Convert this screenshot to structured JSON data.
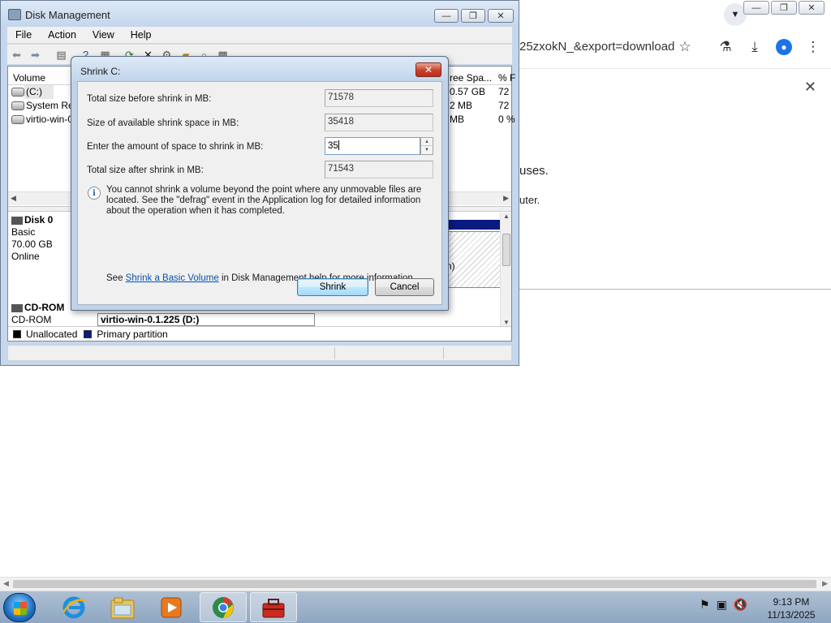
{
  "browser": {
    "url_fragment": "25zxokN_&export=download",
    "content_text_1": "uses.",
    "content_text_2": "uter.",
    "win_ctrls": [
      "—",
      "❐",
      "✕"
    ],
    "tab_dropdown_icon": "chevron-down-icon"
  },
  "disk_mgmt": {
    "title": "Disk Management",
    "menu": [
      "File",
      "Action",
      "View",
      "Help"
    ],
    "columns": [
      "Volume",
      "ree Spa...",
      "% F"
    ],
    "volumes": [
      {
        "name": "(C:)",
        "free": "0.57 GB",
        "pct": "72"
      },
      {
        "name": "System Res",
        "free": "2 MB",
        "pct": "72"
      },
      {
        "name": "virtio-win-0",
        "free": "MB",
        "pct": "0 %"
      }
    ],
    "disk0": {
      "name": "Disk 0",
      "type": "Basic",
      "size": "70.00 GB",
      "status": "Online"
    },
    "partition_text": "n)",
    "cdrom": {
      "name": "CD-ROM",
      "type": "CD-ROM",
      "volume": "virtio-win-0.1.225 (D:)"
    },
    "legend": [
      {
        "label": "Unallocated",
        "color": "#000000"
      },
      {
        "label": "Primary partition",
        "color": "#0a1a80"
      }
    ]
  },
  "dialog": {
    "title": "Shrink C:",
    "fields": {
      "total_before": {
        "label": "Total size before shrink in MB:",
        "value": "71578"
      },
      "available": {
        "label": "Size of available shrink space in MB:",
        "value": "35418"
      },
      "amount": {
        "label": "Enter the amount of space to shrink in MB:",
        "value": "35"
      },
      "total_after": {
        "label": "Total size after shrink in MB:",
        "value": "71543"
      }
    },
    "info": "You cannot shrink a volume beyond the point where any unmovable files are located. See the \"defrag\" event in the Application log for detailed information about the operation when it has completed.",
    "see_prefix": "See",
    "see_link": "Shrink a Basic Volume",
    "see_suffix": "in Disk Management help for more information.",
    "shrink_label": "Shrink",
    "cancel_label": "Cancel"
  },
  "taskbar": {
    "time": "9:13 PM",
    "date": "11/13/2025"
  }
}
